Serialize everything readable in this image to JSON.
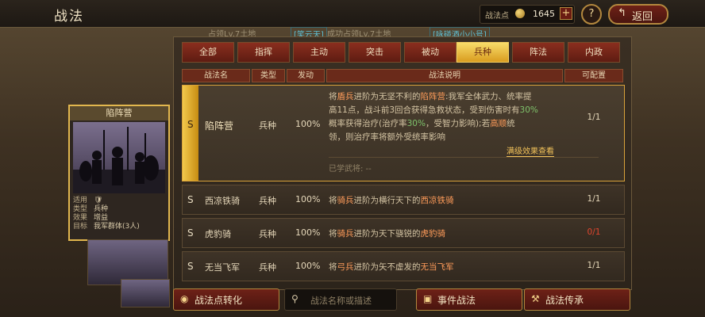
{
  "header": {
    "title": "战法",
    "points_label": "战法点",
    "points_value": "1645",
    "plus": "+",
    "help": "?",
    "back_arrow": "↰",
    "back_label": "返回"
  },
  "background_feed": {
    "item1": "占领Lv.7土地",
    "tag1": "[笑云天]",
    "item2": "成功占领Lv.7土地",
    "tag2": "[咏碰酒小小号]"
  },
  "tabs": [
    "全部",
    "指挥",
    "主动",
    "突击",
    "被动",
    "兵种",
    "阵法",
    "内政"
  ],
  "active_tab": "兵种",
  "columns": [
    "战法名",
    "类型",
    "发动",
    "战法说明",
    "可配置"
  ],
  "rows": [
    {
      "grade": "S",
      "name": "陷阵营",
      "type": "兵种",
      "rate": "100%",
      "desc_lines": [
        [
          "将",
          "盾兵",
          "进阶为无坚不利的",
          "陷阵营",
          ":我军全体武力、统率提"
        ],
        [
          "高11点，战斗前3回合获得急救状态，受到伤害时有",
          "30%"
        ],
        [
          "概率获得治疗(治疗率",
          "30%",
          "，受智力影响);若",
          "高顺",
          "统"
        ],
        [
          "领，则治疗率将额外受统率影响"
        ]
      ],
      "more_link": "满级效果查看",
      "learned": "已学武将:  --",
      "slots": "1/1"
    },
    {
      "grade": "S",
      "name": "西凉铁骑",
      "type": "兵种",
      "rate": "100%",
      "desc_pre": "将",
      "desc_hl1": "骑兵",
      "desc_mid": "进阶为横行天下的",
      "desc_hl2": "西凉铁骑",
      "slots": "1/1"
    },
    {
      "grade": "S",
      "name": "虎豹骑",
      "type": "兵种",
      "rate": "100%",
      "desc_pre": "将",
      "desc_hl1": "骑兵",
      "desc_mid": "进阶为天下骁锐的",
      "desc_hl2": "虎豹骑",
      "slots": "0/1"
    },
    {
      "grade": "S",
      "name": "无当飞军",
      "type": "兵种",
      "rate": "100%",
      "desc_pre": "将",
      "desc_hl1": "弓兵",
      "desc_mid": "进阶为矢不虚发的",
      "desc_hl2": "无当飞军",
      "slots": "1/1"
    }
  ],
  "card": {
    "title": "陷阵营",
    "fields": [
      {
        "k": "适用",
        "v": "🛡"
      },
      {
        "k": "类型",
        "v": "兵种"
      },
      {
        "k": "效果",
        "v": "增益"
      },
      {
        "k": "目标",
        "v": "我军群体(3人)"
      }
    ]
  },
  "bottom": {
    "convert": "战法点转化",
    "search_placeholder": "战法名称或描述",
    "event": "事件战法",
    "inherit": "战法传承"
  },
  "colors": {
    "accent": "#f2c94c",
    "button": "#6e2117",
    "highlight": "#ff9c5a",
    "slots_zero": "#e0452e"
  }
}
